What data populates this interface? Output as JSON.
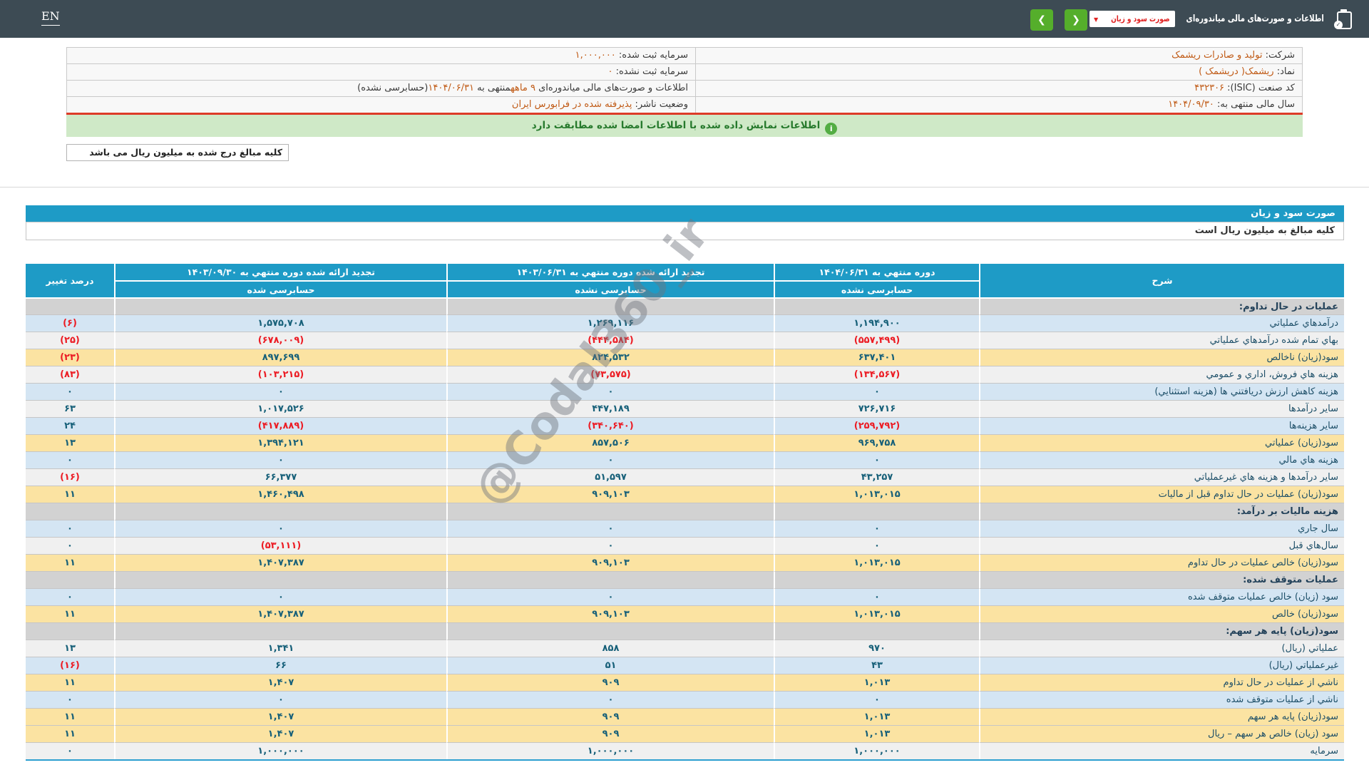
{
  "header": {
    "en_link": "EN",
    "title": "اطلاعات و صورت‌های مالی میاندوره‌ای",
    "report_dropdown_value": "صورت سود و زیان",
    "nav_back_icon": "❮",
    "nav_forward_icon": "❯"
  },
  "company_info": {
    "rows": [
      {
        "right": [
          {
            "t": "شرکت:  ",
            "o": false
          },
          {
            "t": "تولید و صادرات ریشمک",
            "o": true
          }
        ],
        "left": [
          {
            "t": "سرمایه ثبت شده:  ",
            "o": false
          },
          {
            "t": "۱,۰۰۰,۰۰۰",
            "o": true
          }
        ]
      },
      {
        "right": [
          {
            "t": "نماد:  ",
            "o": false
          },
          {
            "t": "ریشمک( دریشمک )",
            "o": true
          }
        ],
        "left": [
          {
            "t": "سرمایه ثبت نشده:  ",
            "o": false
          },
          {
            "t": "۰",
            "o": true
          }
        ]
      },
      {
        "right": [
          {
            "t": "کد صنعت (ISIC):  ",
            "o": false
          },
          {
            "t": "۴۳۲۳۰۶",
            "o": true
          }
        ],
        "left": [
          {
            "t": "اطلاعات و صورت‌های مالی میاندوره‌ای ",
            "o": false
          },
          {
            "t": "۹ ماهه",
            "o": true
          },
          {
            "t": "منتهی به ",
            "o": false
          },
          {
            "t": "۱۴۰۴/۰۶/۳۱",
            "o": true
          },
          {
            "t": "(حسابرسی نشده)",
            "o": false
          }
        ]
      },
      {
        "right": [
          {
            "t": "سال مالی منتهی به:  ",
            "o": false
          },
          {
            "t": "۱۴۰۴/۰۹/۳۰",
            "o": true
          }
        ],
        "left": [
          {
            "t": "وضعیت ناشر:  ",
            "o": false
          },
          {
            "t": "پذیرفته شده در فرابورس ایران",
            "o": true
          }
        ]
      }
    ]
  },
  "signature_notice": "اطلاعات نمایش داده شده با اطلاعات امضا شده مطابقت دارد",
  "amounts_note": "کلیه مبالغ درج شده به میلیون ریال می باشد",
  "statement": {
    "title": "صورت سود و زیان",
    "unit_note": "کلیه مبالغ به میلیون ریال است",
    "desc_header": "شرح",
    "pct_header": "درصد تغییر",
    "columns": [
      {
        "period": "دوره منتهي به ۱۴۰۴/۰۶/۳۱",
        "audit": "حسابرسی نشده"
      },
      {
        "period": "تجدید ارائه شده دوره منتهي به ۱۴۰۳/۰۶/۳۱",
        "audit": "حسابرسی نشده"
      },
      {
        "period": "تجدید ارائه شده دوره منتهي به ۱۴۰۳/۰۹/۳۰",
        "audit": "حسابرسی شده"
      }
    ],
    "rows": [
      {
        "type": "section",
        "label": "عملیات در حال تداوم:"
      },
      {
        "type": "data",
        "bg": "blue",
        "label": "درآمدهاي عملياتي",
        "v": [
          "۱,۱۹۴,۹۰۰",
          "۱,۲۶۹,۱۱۶",
          "۱,۵۷۵,۷۰۸"
        ],
        "pct": "(۶)"
      },
      {
        "type": "data",
        "bg": "white",
        "label": "بهاي تمام شده درآمدهاي عملياتي",
        "v": [
          "(۵۵۷,۴۹۹)",
          "(۴۴۴,۵۸۴)",
          "(۶۷۸,۰۰۹)"
        ],
        "pct": "(۲۵)"
      },
      {
        "type": "data",
        "bg": "yellow",
        "label": "سود(زیان) ناخالص",
        "v": [
          "۶۳۷,۴۰۱",
          "۸۲۴,۵۳۲",
          "۸۹۷,۶۹۹"
        ],
        "pct": "(۲۳)"
      },
      {
        "type": "data",
        "bg": "white",
        "label": "هزینه هاي فروش، اداري و عمومي",
        "v": [
          "(۱۳۴,۵۶۷)",
          "(۷۳,۵۷۵)",
          "(۱۰۳,۲۱۵)"
        ],
        "pct": "(۸۳)"
      },
      {
        "type": "data",
        "bg": "blue",
        "label": "هزینه کاهش ارزش دریافتني ها (هزینه استثنايي)",
        "v": [
          "۰",
          "۰",
          "۰"
        ],
        "pct": "۰"
      },
      {
        "type": "data",
        "bg": "white",
        "label": "سایر درآمدها",
        "v": [
          "۷۲۶,۷۱۶",
          "۴۴۷,۱۸۹",
          "۱,۰۱۷,۵۲۶"
        ],
        "pct": "۶۳"
      },
      {
        "type": "data",
        "bg": "blue",
        "label": "سایر هزینه‌ها",
        "v": [
          "(۲۵۹,۷۹۲)",
          "(۳۴۰,۶۴۰)",
          "(۴۱۷,۸۸۹)"
        ],
        "pct": "۲۴"
      },
      {
        "type": "data",
        "bg": "yellow",
        "label": "سود(زیان) عملیاتي",
        "v": [
          "۹۶۹,۷۵۸",
          "۸۵۷,۵۰۶",
          "۱,۳۹۴,۱۲۱"
        ],
        "pct": "۱۳"
      },
      {
        "type": "data",
        "bg": "blue",
        "label": "هزینه هاي مالي",
        "v": [
          "۰",
          "۰",
          "۰"
        ],
        "pct": "۰"
      },
      {
        "type": "data",
        "bg": "white",
        "label": "سایر درآمدها و هزینه هاي غیرعملیاتي",
        "v": [
          "۴۳,۲۵۷",
          "۵۱,۵۹۷",
          "۶۶,۳۷۷"
        ],
        "pct": "(۱۶)"
      },
      {
        "type": "data",
        "bg": "yellow",
        "label": "سود(زیان) عملیات در حال تداوم قبل از مالیات",
        "v": [
          "۱,۰۱۳,۰۱۵",
          "۹۰۹,۱۰۳",
          "۱,۴۶۰,۴۹۸"
        ],
        "pct": "۱۱"
      },
      {
        "type": "section",
        "label": "هزینه مالیات بر درآمد:"
      },
      {
        "type": "data",
        "bg": "blue",
        "label": "سال جاري",
        "v": [
          "۰",
          "۰",
          "۰"
        ],
        "pct": "۰"
      },
      {
        "type": "data",
        "bg": "white",
        "label": "سال‌هاي قبل",
        "v": [
          "۰",
          "۰",
          "(۵۳,۱۱۱)"
        ],
        "pct": "۰"
      },
      {
        "type": "data",
        "bg": "yellow",
        "label": "سود(زیان) خالص عملیات در حال تداوم",
        "v": [
          "۱,۰۱۳,۰۱۵",
          "۹۰۹,۱۰۳",
          "۱,۴۰۷,۳۸۷"
        ],
        "pct": "۱۱"
      },
      {
        "type": "section",
        "label": "عملیات متوقف شده:"
      },
      {
        "type": "data",
        "bg": "blue",
        "label": "سود (زیان) خالص عملیات متوقف شده",
        "v": [
          "۰",
          "۰",
          "۰"
        ],
        "pct": "۰"
      },
      {
        "type": "data",
        "bg": "yellow",
        "label": "سود(زیان) خالص",
        "v": [
          "۱,۰۱۳,۰۱۵",
          "۹۰۹,۱۰۳",
          "۱,۴۰۷,۳۸۷"
        ],
        "pct": "۱۱"
      },
      {
        "type": "section",
        "label": "سود(زیان) پایه هر سهم:"
      },
      {
        "type": "data",
        "bg": "white",
        "label": "عملیاتي (ریال)",
        "v": [
          "۹۷۰",
          "۸۵۸",
          "۱,۳۴۱"
        ],
        "pct": "۱۳"
      },
      {
        "type": "data",
        "bg": "blue",
        "label": "غیرعملیاتي (ریال)",
        "v": [
          "۴۳",
          "۵۱",
          "۶۶"
        ],
        "pct": "(۱۶)"
      },
      {
        "type": "data",
        "bg": "yellow",
        "label": "ناشي از عملیات در حال تداوم",
        "v": [
          "۱,۰۱۳",
          "۹۰۹",
          "۱,۴۰۷"
        ],
        "pct": "۱۱"
      },
      {
        "type": "data",
        "bg": "blue",
        "label": "ناشي از عملیات متوقف شده",
        "v": [
          "۰",
          "۰",
          "۰"
        ],
        "pct": "۰"
      },
      {
        "type": "data",
        "bg": "yellow",
        "label": "سود(زیان) پایه هر سهم",
        "v": [
          "۱,۰۱۳",
          "۹۰۹",
          "۱,۴۰۷"
        ],
        "pct": "۱۱"
      },
      {
        "type": "data",
        "bg": "yellow",
        "label": "سود (زیان) خالص هر سهم – ریال",
        "v": [
          "۱,۰۱۳",
          "۹۰۹",
          "۱,۴۰۷"
        ],
        "pct": "۱۱"
      },
      {
        "type": "data",
        "bg": "white",
        "label": "سرمایه",
        "v": [
          "۱,۰۰۰,۰۰۰",
          "۱,۰۰۰,۰۰۰",
          "۱,۰۰۰,۰۰۰"
        ],
        "pct": "۰"
      }
    ]
  },
  "watermark": "@Codal360_ir",
  "colors": {
    "header_bg": "#3d4b54",
    "accent_blue": "#1e9bc6",
    "row_blue": "#d4e5f3",
    "row_white": "#f0f0f0",
    "row_yellow": "#fbe3a2",
    "row_section": "#d2d2d2",
    "negative_red": "#ec1c24",
    "value_orange": "#c05a15",
    "green_bar_bg": "#cfe9c7",
    "green_text": "#277a2d",
    "red_line": "#dd3b28",
    "nav_green": "#55ae2b",
    "dropdown_text_red": "#e02222"
  }
}
